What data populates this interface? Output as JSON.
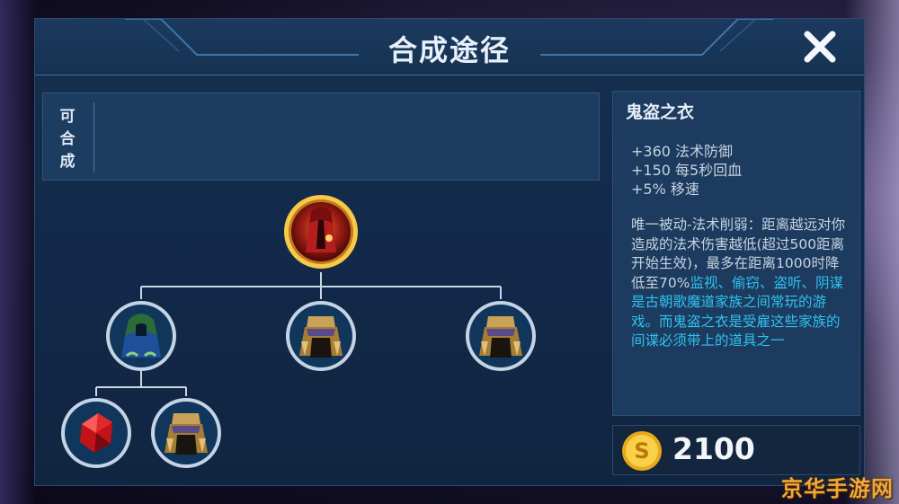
{
  "header": {
    "title": "合成途径",
    "close_icon": "close-icon"
  },
  "craftable": {
    "label_lines": [
      "可",
      "合",
      "成"
    ]
  },
  "item": {
    "name": "鬼盗之衣",
    "stats": [
      "+360 法术防御",
      "+150 每5秒回血",
      "+5% 移速"
    ],
    "passive": "唯一被动-法术削弱：距离越远对你造成的法术伤害越低(超过500距离开始生效)，最多在距离1000时降低至70%",
    "lore": "监视、偷窃、盗听、阴谋是古朝歌魔道家族之间常玩的游戏。而鬼盗之衣是受雇这些家族的间谍必须带上的道具之一",
    "price": "2100",
    "price_icon": "gold-coin-icon"
  },
  "tree": {
    "root": {
      "name": "鬼盗之衣",
      "icon": "hooded-robe-red-icon"
    },
    "children": [
      {
        "icon": "blue-hooded-cloak-icon",
        "children": [
          {
            "icon": "red-gem-icon"
          },
          {
            "icon": "gold-armor-cape-icon"
          }
        ]
      },
      {
        "icon": "gold-armor-cape-icon"
      },
      {
        "icon": "gold-armor-cape-icon"
      }
    ]
  },
  "colors": {
    "lore_text": "#2fc3f0",
    "accent_gold": "#f5c842",
    "panel_bg": "#12294a"
  },
  "watermark": "京华手游网"
}
